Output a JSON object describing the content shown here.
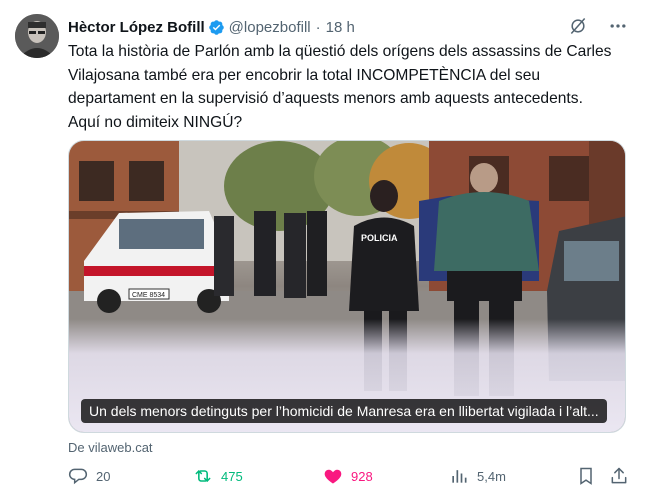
{
  "author": {
    "name": "Hèctor López Bofill",
    "handle": "@lopezbofill",
    "separator": "·",
    "time": "18 h"
  },
  "tweet": {
    "text_lines": [
      "Tota la història de Parlón amb la qüestió dels orígens dels assassins de Carles",
      "Vilajosana també era per encobrir la total INCOMPETÈNCIA del seu",
      "departament en la supervisió d’aquests menors amb aquests antecedents.",
      "Aquí no dimiteix NINGÚ?"
    ]
  },
  "media": {
    "caption": "Un dels menors detinguts per l’homicidi de Manresa era en llibertat vigilada i l’alt...",
    "car_plate": "CME 8534",
    "vest_text": "POLICIA"
  },
  "link": {
    "source": "De vilaweb.cat"
  },
  "actions": {
    "replies": "20",
    "retweets": "475",
    "likes": "928",
    "views": "5,4m"
  },
  "colors": {
    "verified": "#1d9bf0",
    "retweet_active": "#00ba7c",
    "like_active": "#f91880",
    "muted": "#536471"
  }
}
